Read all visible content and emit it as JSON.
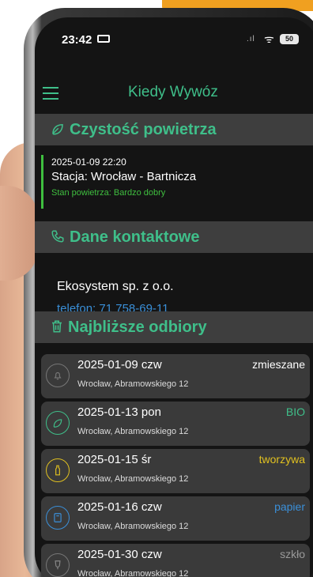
{
  "status_bar": {
    "time": "23:42",
    "signal": ".ıl",
    "wifi": "ᯤ",
    "battery": "50"
  },
  "appbar": {
    "title": "Kiedy Wywóz",
    "menu_icon": "hamburger-icon"
  },
  "air_quality": {
    "header": "Czystość powietrza",
    "icon": "leaf-icon",
    "date": "2025-01-09 22:20",
    "station": "Stacja: Wrocław - Bartnicza",
    "status": "Stan powietrza: Bardzo dobry",
    "status_color": "#3fbf3f"
  },
  "contact": {
    "header": "Dane kontaktowe",
    "icon": "phone-icon",
    "org": "Ekosystem sp. z o.o.",
    "phone": "telefon: 71 758-69-11"
  },
  "pickups": {
    "header": "Najbliższe odbiory",
    "icon": "trash-icon",
    "items": [
      {
        "date": "2025-01-09 czw",
        "address": "Wrocław, Abramowskiego 12",
        "type": "zmieszane",
        "color": "#ffffff",
        "icon": "bell-icon"
      },
      {
        "date": "2025-01-13 pon",
        "address": "Wrocław, Abramowskiego 12",
        "type": "BIO",
        "color": "#3fbf8a",
        "icon": "leaf-icon"
      },
      {
        "date": "2025-01-15 śr",
        "address": "Wrocław, Abramowskiego 12",
        "type": "tworzywa",
        "color": "#e0c020",
        "icon": "bottle-icon"
      },
      {
        "date": "2025-01-16 czw",
        "address": "Wrocław, Abramowskiego 12",
        "type": "papier",
        "color": "#3a8fd8",
        "icon": "paper-icon"
      },
      {
        "date": "2025-01-30 czw",
        "address": "Wrocław, Abramowskiego 12",
        "type": "szkło",
        "color": "#9a9a9a",
        "icon": "glass-icon"
      }
    ]
  },
  "colors": {
    "accent": "#3fbf8a",
    "section_bg": "#3e3e3e",
    "screen_bg": "#141414"
  }
}
